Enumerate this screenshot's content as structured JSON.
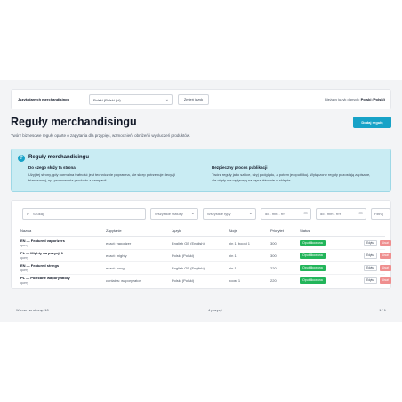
{
  "language_bar": {
    "label": "Język danych merchandisingu",
    "select_value": "Polski (Polski (pl)",
    "change_button": "Zmień język",
    "current_label": "Bieżący język danych:",
    "current_value": "Polski (Polski)"
  },
  "header": {
    "title": "Reguły merchandisingu",
    "add_button": "Dodaj regułę",
    "description": "Twórz biznesowe reguły oparte o zapytania dla przypięć, wzmocnień, obniżeń i wykluczeń produktów."
  },
  "info": {
    "icon": "question-icon",
    "title": "Reguły merchandisingu",
    "col1_title": "Do czego służy ta strona",
    "col1_text": "Użyj tej strony, gdy normalna trafność jest technicznie poprawna, ale sklep potrzebuje decyzji biznesowej, np. promowania produktu z kampanii.",
    "col2_title": "Bezpieczny proces publikacji",
    "col2_text": "Twórz reguły jako szkice, użyj podglądu, a potem je opublikuj. Wyłączone reguły pozostają zapisane, ale nigdy nie wpływają na wyszukiwanie w sklepie."
  },
  "filters": {
    "search_placeholder": "Szukaj",
    "status": "Wszystkie statusy",
    "types": "Wszystkie typy",
    "date_from": "dd . mm . rrrr",
    "date_to": "dd . mm . rrrr",
    "filter_button": "Filtruj"
  },
  "table": {
    "headers": [
      "Nazwa",
      "Zapytanie",
      "Język",
      "Akcje",
      "Priorytet",
      "Status"
    ],
    "rows": [
      {
        "name": "EN — Featured vaporizers",
        "sub": "query",
        "query": "exact: vaporizer",
        "lang": "English GB (English)",
        "actions": "pin 1, boost 1",
        "priority": "300",
        "status": "Opublikowana"
      },
      {
        "name": "PL — Mighty na pozycji 1",
        "sub": "query",
        "query": "exact: mighty",
        "lang": "Polski (Polski)",
        "actions": "pin 1",
        "priority": "300",
        "status": "Opublikowana"
      },
      {
        "name": "EN — Featured strings",
        "sub": "query",
        "query": "exact: bong",
        "lang": "English GB (English)",
        "actions": "pin 1",
        "priority": "220",
        "status": "Opublikowana"
      },
      {
        "name": "PL — Polecane waporyzatory",
        "sub": "query",
        "query": "contains: waporyzator",
        "lang": "Polski (Polski)",
        "actions": "boost 1",
        "priority": "220",
        "status": "Opublikowana"
      }
    ],
    "edit_label": "Edytuj",
    "delete_label": "Usuń"
  },
  "pagination": {
    "rows_per_page": "Wiersz na stronę: 10",
    "count": "4 pozycji",
    "pages": "1 / 1"
  },
  "colors": {
    "accent": "#17a2c7",
    "published": "#22b55a",
    "delete": "#ef8f8f",
    "info_bg": "#c9ecf3"
  }
}
